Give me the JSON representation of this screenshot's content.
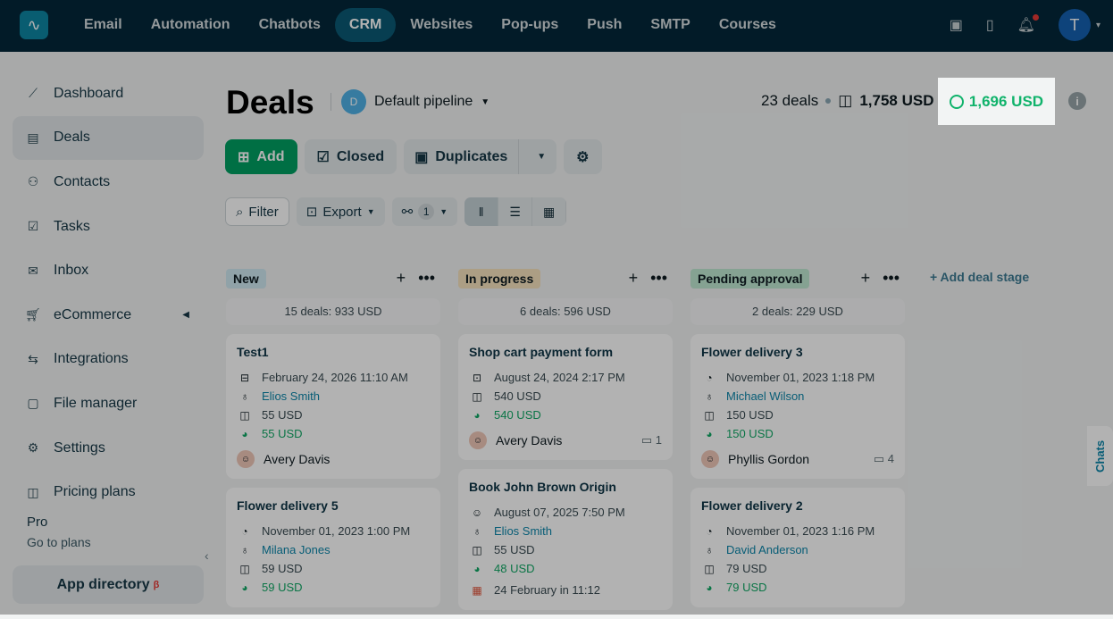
{
  "nav": {
    "items": [
      "Email",
      "Automation",
      "Chatbots",
      "CRM",
      "Websites",
      "Pop-ups",
      "Push",
      "SMTP",
      "Courses"
    ],
    "active": "CRM",
    "avatar": "T"
  },
  "sidebar": {
    "items": [
      "Dashboard",
      "Deals",
      "Contacts",
      "Tasks",
      "Inbox",
      "eCommerce",
      "Integrations",
      "File manager",
      "Settings",
      "Pricing plans"
    ],
    "plan": "Pro",
    "plan_link": "Go to plans",
    "app_directory": "App directory",
    "beta": "β"
  },
  "header": {
    "title": "Deals",
    "pipeline_initial": "D",
    "pipeline": "Default pipeline",
    "deals_count": "23 deals",
    "total": "1,758 USD",
    "weighted": "1,696 USD",
    "info": "i"
  },
  "buttons": {
    "add": "Add",
    "closed": "Closed",
    "duplicates": "Duplicates"
  },
  "tools": {
    "filter": "Filter",
    "export": "Export",
    "flow_count": "1"
  },
  "add_stage": "Add deal stage",
  "chats": "Chats",
  "columns": [
    {
      "stage": "New",
      "color": "#cfe9f1",
      "summary": "15 deals: 933 USD",
      "cards": [
        {
          "title": "Test1",
          "date": "February 24, 2026 11:10 AM",
          "contact": "Elios Smith",
          "amount": "55 USD",
          "weighted": "55 USD",
          "owner": "Avery Davis",
          "comments": ""
        },
        {
          "title": "Flower delivery 5",
          "date": "November 01, 2023 1:00 PM",
          "contact": "Milana Jones",
          "amount": "59 USD",
          "weighted": "59 USD"
        }
      ]
    },
    {
      "stage": "In progress",
      "color": "#f6e3bd",
      "summary": "6 deals: 596 USD",
      "cards": [
        {
          "title": "Shop cart payment form",
          "date": "August 24, 2024 2:17 PM",
          "amount": "540 USD",
          "weighted": "540 USD",
          "owner": "Avery Davis",
          "comments": "1"
        },
        {
          "title": "Book John Brown Origin",
          "date": "August 07, 2025 7:50 PM",
          "contact": "Elios Smith",
          "amount": "55 USD",
          "weighted": "48 USD",
          "task": "24 February in 11:12"
        }
      ]
    },
    {
      "stage": "Pending approval",
      "color": "#bfe8d2",
      "summary": "2 deals: 229 USD",
      "cards": [
        {
          "title": "Flower delivery 3",
          "date": "November 01, 2023 1:18 PM",
          "contact": "Michael Wilson",
          "amount": "150 USD",
          "weighted": "150 USD",
          "owner": "Phyllis Gordon",
          "comments": "4"
        },
        {
          "title": "Flower delivery 2",
          "date": "November 01, 2023 1:16 PM",
          "contact": "David Anderson",
          "amount": "79 USD",
          "weighted": "79 USD"
        }
      ]
    }
  ]
}
